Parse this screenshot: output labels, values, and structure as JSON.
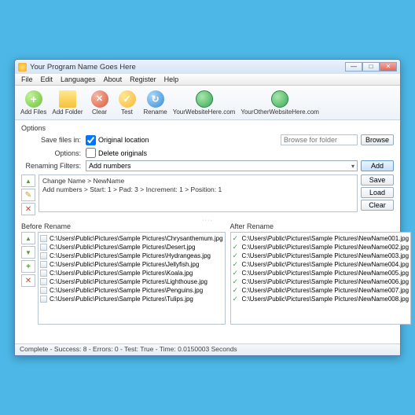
{
  "title": "Your Program Name Goes Here",
  "menu": [
    "File",
    "Edit",
    "Languages",
    "About",
    "Register",
    "Help"
  ],
  "toolbar": [
    {
      "label": "Add Files",
      "icon": "ic-add"
    },
    {
      "label": "Add Folder",
      "icon": "ic-folder"
    },
    {
      "label": "Clear",
      "icon": "ic-clear"
    },
    {
      "label": "Test",
      "icon": "ic-test"
    },
    {
      "label": "Rename",
      "icon": "ic-rename"
    },
    {
      "label": "YourWebsiteHere.com",
      "icon": "ic-globe"
    },
    {
      "label": "YourOtherWebsiteHere.com",
      "icon": "ic-globe"
    }
  ],
  "options": {
    "group_label": "Options",
    "save_label": "Save files in:",
    "save_check": "Original location",
    "browse_placeholder": "Browse for folder",
    "browse_btn": "Browse",
    "opts_label": "Options:",
    "delete_check": "Delete originals",
    "filter_label": "Renaming Filters:",
    "filter_value": "Add numbers",
    "add_btn": "Add"
  },
  "rules": {
    "lines": [
      "Change Name > NewName",
      "Add numbers > Start: 1 > Pad: 3 > Increment: 1 > Position: 1"
    ],
    "save_btn": "Save",
    "load_btn": "Load",
    "clear_btn": "Clear"
  },
  "before": {
    "label": "Before Rename",
    "items": [
      "C:\\Users\\Public\\Pictures\\Sample Pictures\\Chrysanthemum.jpg",
      "C:\\Users\\Public\\Pictures\\Sample Pictures\\Desert.jpg",
      "C:\\Users\\Public\\Pictures\\Sample Pictures\\Hydrangeas.jpg",
      "C:\\Users\\Public\\Pictures\\Sample Pictures\\Jellyfish.jpg",
      "C:\\Users\\Public\\Pictures\\Sample Pictures\\Koala.jpg",
      "C:\\Users\\Public\\Pictures\\Sample Pictures\\Lighthouse.jpg",
      "C:\\Users\\Public\\Pictures\\Sample Pictures\\Penguins.jpg",
      "C:\\Users\\Public\\Pictures\\Sample Pictures\\Tulips.jpg"
    ]
  },
  "after": {
    "label": "After Rename",
    "items": [
      "C:\\Users\\Public\\Pictures\\Sample Pictures\\NewName001.jpg",
      "C:\\Users\\Public\\Pictures\\Sample Pictures\\NewName002.jpg",
      "C:\\Users\\Public\\Pictures\\Sample Pictures\\NewName003.jpg",
      "C:\\Users\\Public\\Pictures\\Sample Pictures\\NewName004.jpg",
      "C:\\Users\\Public\\Pictures\\Sample Pictures\\NewName005.jpg",
      "C:\\Users\\Public\\Pictures\\Sample Pictures\\NewName006.jpg",
      "C:\\Users\\Public\\Pictures\\Sample Pictures\\NewName007.jpg",
      "C:\\Users\\Public\\Pictures\\Sample Pictures\\NewName008.jpg"
    ]
  },
  "status": "Complete - Success: 8 - Errors: 0 - Test: True - Time: 0.0150003 Seconds"
}
